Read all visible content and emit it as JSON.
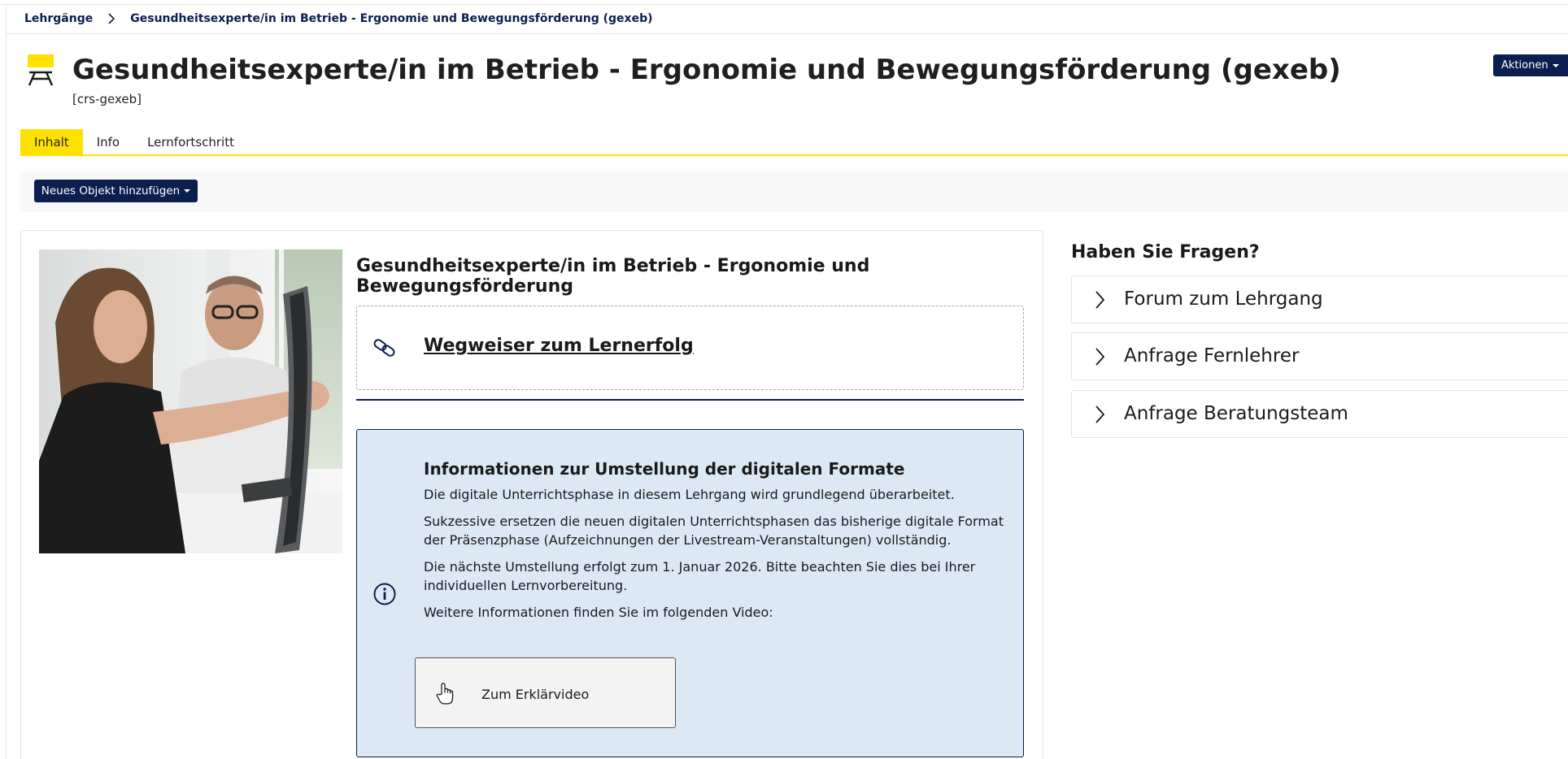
{
  "breadcrumb": {
    "items": [
      "Lehrgänge",
      "Gesundheitsexperte/in im Betrieb - Ergonomie und Bewegungsförderung (gexeb)"
    ]
  },
  "header": {
    "title": "Gesundheitsexperte/in im Betrieb - Ergonomie und Bewegungsförderung (gexeb)",
    "subtitle": "[crs-gexeb]",
    "actions_label": "Aktionen",
    "course_icon": "course-icon"
  },
  "tabs": [
    {
      "label": "Inhalt",
      "active": true
    },
    {
      "label": "Info",
      "active": false
    },
    {
      "label": "Lernfortschritt",
      "active": false
    }
  ],
  "toolbar": {
    "add_label": "Neues Objekt hinzufügen"
  },
  "main": {
    "item_title": "Gesundheitsexperte/in im Betrieb - Ergonomie und Bewegungsförde­rung",
    "link_text": "Wegweiser zum Lernerfolg",
    "link_icon": "link-icon",
    "info": {
      "icon": "info-icon",
      "heading": "Informationen zur Umstellung der digitalen Formate",
      "paragraphs": [
        "Die digitale Unterrichtsphase in diesem Lehrgang wird grundlegend überarbeitet.",
        "Sukzessive ersetzen die neuen digitalen Unterrichtsphasen das bisherige digitale Format der Präsenzphase (Aufzeichnungen der Livestream-Veranstaltungen) vollständig.",
        "Die nächste Umstellung erfolgt zum 1. Januar 2026. Bitte beachten Sie dies bei Ihrer individu­ellen Lernvorbereitung.",
        "Weitere Informationen finden Sie im folgenden Video:"
      ],
      "video_button": "Zum Erklärvideo"
    }
  },
  "sidebar": {
    "heading": "Haben Sie Fragen?",
    "items": [
      "Forum zum Lehrgang",
      "Anfrage Fernlehrer",
      "Anfrage Beratungsteam"
    ]
  },
  "colors": {
    "accent": "#ffe100",
    "navy": "#0b1f4e",
    "info_bg": "#dce9f5",
    "toolbar_bg": "#f8f8f8"
  }
}
